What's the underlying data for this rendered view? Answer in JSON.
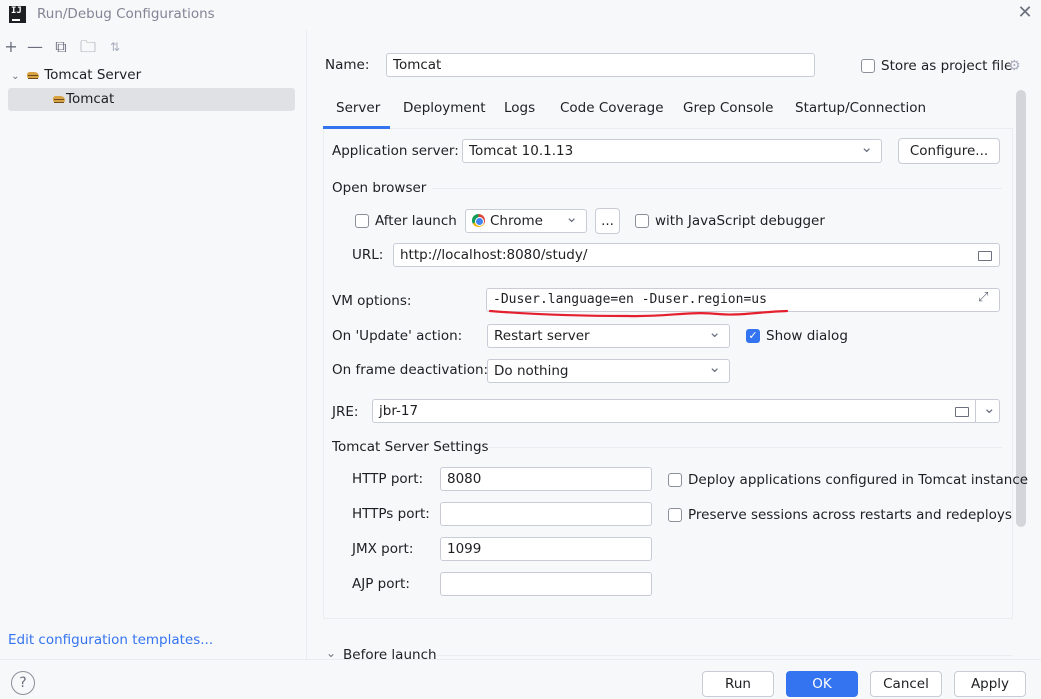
{
  "window": {
    "title": "Run/Debug Configurations"
  },
  "left": {
    "tree": [
      {
        "label": "Tomcat Server"
      },
      {
        "label": "Tomcat"
      }
    ],
    "edit_templates": "Edit configuration templates..."
  },
  "name": {
    "label": "Name:",
    "value": "Tomcat"
  },
  "store_as_project": {
    "label": "Store as project file",
    "checked": false
  },
  "tabs": [
    "Server",
    "Deployment",
    "Logs",
    "Code Coverage",
    "Grep Console",
    "Startup/Connection"
  ],
  "active_tab": "Server",
  "server": {
    "app_server_label": "Application server:",
    "app_server_value": "Tomcat 10.1.13",
    "configure_label": "Configure...",
    "open_browser_label": "Open browser",
    "after_launch_label": "After launch",
    "browser_value": "Chrome",
    "ellipsis_label": "...",
    "js_debugger_label": "with JavaScript debugger",
    "url_label": "URL:",
    "url_value": "http://localhost:8080/study/",
    "vm_options_label": "VM options:",
    "vm_options_value": "-Duser.language=en -Duser.region=us",
    "on_update_label": "On 'Update' action:",
    "on_update_value": "Restart server",
    "show_dialog_label": "Show dialog",
    "show_dialog_checked": true,
    "frame_deactivation_label": "On frame deactivation:",
    "frame_deactivation_value": "Do nothing",
    "jre_label": "JRE:",
    "jre_value": "jbr-17",
    "tomcat_settings_label": "Tomcat Server Settings",
    "http_port_label": "HTTP port:",
    "http_port_value": "8080",
    "https_port_label": "HTTPs port:",
    "https_port_value": "",
    "jmx_port_label": "JMX port:",
    "jmx_port_value": "1099",
    "ajp_port_label": "AJP port:",
    "ajp_port_value": "",
    "deploy_apps_label": "Deploy applications configured in Tomcat instance",
    "preserve_sessions_label": "Preserve sessions across restarts and redeploys"
  },
  "before_launch_label": "Before launch",
  "buttons": {
    "run": "Run",
    "ok": "OK",
    "cancel": "Cancel",
    "apply": "Apply"
  },
  "colors": {
    "accent": "#3574f0",
    "annotation": "#e5202e"
  }
}
